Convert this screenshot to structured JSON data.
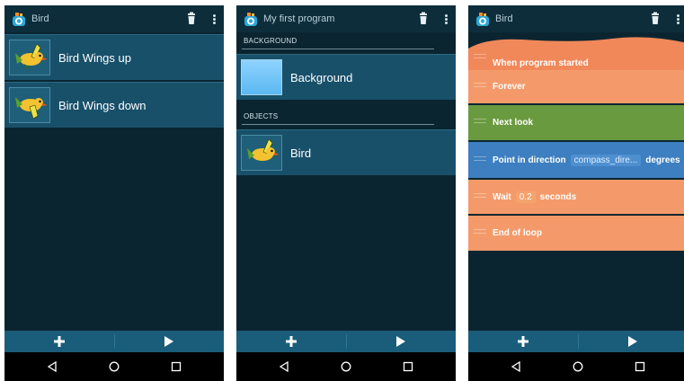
{
  "screens": [
    {
      "title": "Bird",
      "items": [
        {
          "label": "Bird Wings up"
        },
        {
          "label": "Bird Wings down"
        }
      ]
    },
    {
      "title": "My first program",
      "background_header": "BACKGROUND",
      "background_item": "Background",
      "objects_header": "OBJECTS",
      "object_item": "Bird"
    },
    {
      "title": "Bird",
      "bricks": {
        "when_started": "When program started",
        "forever": "Forever",
        "next_look": "Next look",
        "point_direction": "Point in direction",
        "point_direction_value": "compass_dire...",
        "point_direction_unit": "degrees",
        "wait": "Wait",
        "wait_value": "0.2",
        "wait_unit": "seconds",
        "end_loop": "End of loop"
      }
    }
  ],
  "colors": {
    "app_bg": "#0b2530",
    "app_bar": "#0d2d3b",
    "list_item": "#18506a",
    "bottom_bar": "#1a5d7a",
    "brick_event": "#f0885a",
    "brick_control": "#f49a6a",
    "brick_looks": "#6a9a3f",
    "brick_motion": "#3d7fc0"
  },
  "icons": [
    "catrobat-logo-icon",
    "trash-icon",
    "more-vert-icon",
    "add-icon",
    "play-icon",
    "back-icon",
    "home-icon",
    "recents-icon",
    "bird-thumbnail-icon"
  ]
}
